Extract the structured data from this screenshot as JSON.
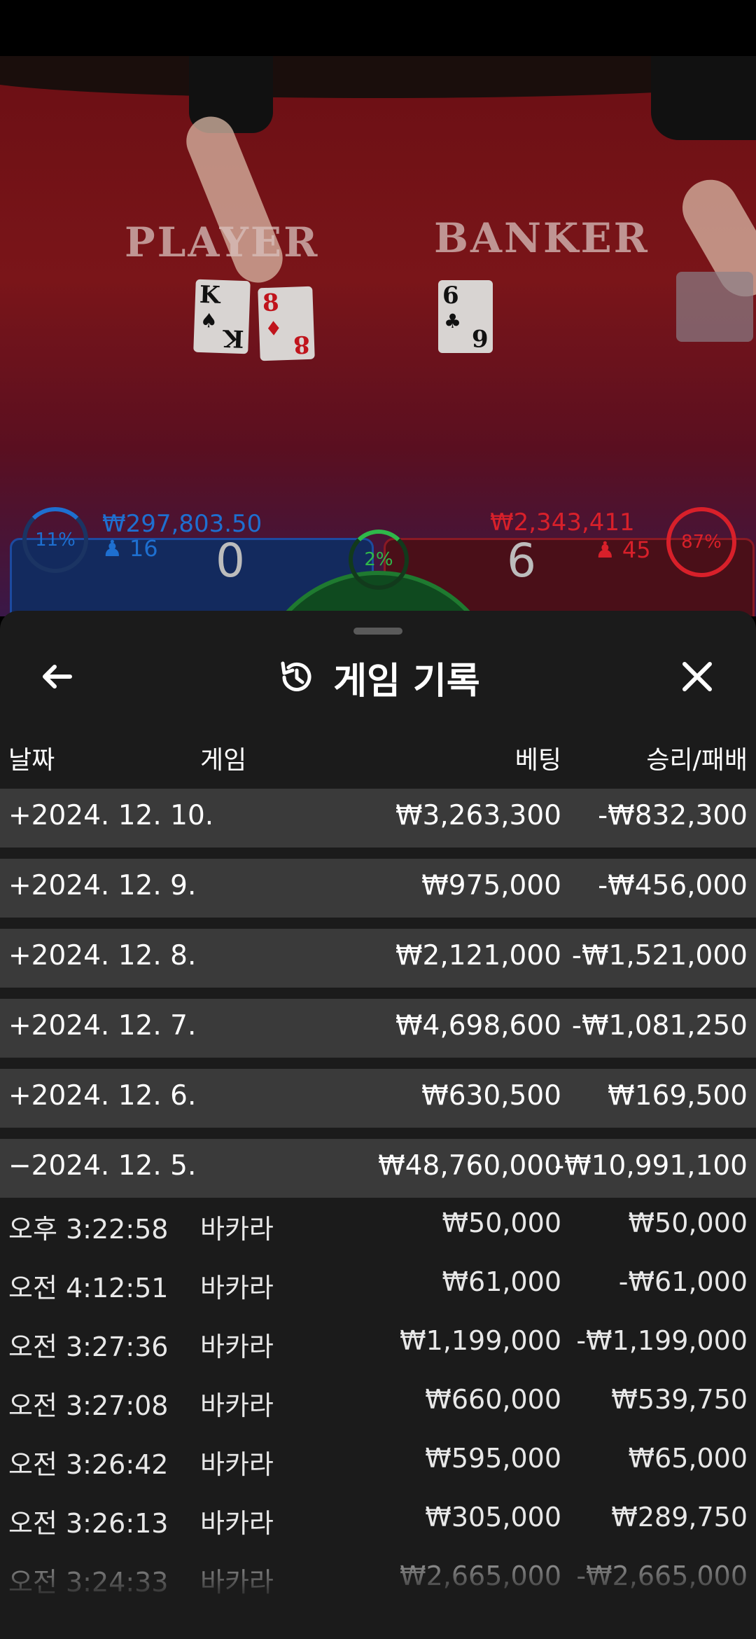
{
  "table": {
    "player_label": "PLAYER",
    "banker_label": "BANKER",
    "player_cards": [
      {
        "rank": "K",
        "suit": "♠",
        "color": "black"
      },
      {
        "rank": "8",
        "suit": "♦",
        "color": "red"
      }
    ],
    "banker_cards": [
      {
        "rank": "6",
        "suit": "♣",
        "color": "black"
      }
    ],
    "player": {
      "percent": "11%",
      "amount": "₩297,803.50",
      "players": "16",
      "score": "0",
      "accent": "#1e6fd0"
    },
    "tie": {
      "percent": "2%",
      "accent": "#2fb84a"
    },
    "banker": {
      "percent": "87%",
      "amount": "₩2,343,411",
      "players": "45",
      "score": "6",
      "accent": "#d8202a"
    }
  },
  "sheet": {
    "title": "게임 기록",
    "back_icon": "arrow-left-icon",
    "history_icon": "history-icon",
    "close_icon": "close-icon",
    "columns": {
      "date": "날짜",
      "game": "게임",
      "bet": "베팅",
      "result": "승리/패배"
    },
    "days": [
      {
        "date": "+2024. 12. 10.",
        "bet": "₩3,263,300",
        "result": "-₩832,300"
      },
      {
        "date": "+2024. 12. 9.",
        "bet": "₩975,000",
        "result": "-₩456,000"
      },
      {
        "date": "+2024. 12. 8.",
        "bet": "₩2,121,000",
        "result": "-₩1,521,000"
      },
      {
        "date": "+2024. 12. 7.",
        "bet": "₩4,698,600",
        "result": "-₩1,081,250"
      },
      {
        "date": "+2024. 12. 6.",
        "bet": "₩630,500",
        "result": "₩169,500"
      },
      {
        "date": "−2024. 12. 5.",
        "bet": "₩48,760,000",
        "result": "-₩10,991,100"
      }
    ],
    "games": [
      {
        "time": "오후 3:22:58",
        "game": "바카라",
        "bet": "₩50,000",
        "result": "₩50,000"
      },
      {
        "time": "오전 4:12:51",
        "game": "바카라",
        "bet": "₩61,000",
        "result": "-₩61,000"
      },
      {
        "time": "오전 3:27:36",
        "game": "바카라",
        "bet": "₩1,199,000",
        "result": "-₩1,199,000"
      },
      {
        "time": "오전 3:27:08",
        "game": "바카라",
        "bet": "₩660,000",
        "result": "₩539,750"
      },
      {
        "time": "오전 3:26:42",
        "game": "바카라",
        "bet": "₩595,000",
        "result": "₩65,000"
      },
      {
        "time": "오전 3:26:13",
        "game": "바카라",
        "bet": "₩305,000",
        "result": "₩289,750"
      },
      {
        "time": "오전 3:24:33",
        "game": "바카라",
        "bet": "₩2,665,000",
        "result": "-₩2,665,000"
      }
    ]
  }
}
